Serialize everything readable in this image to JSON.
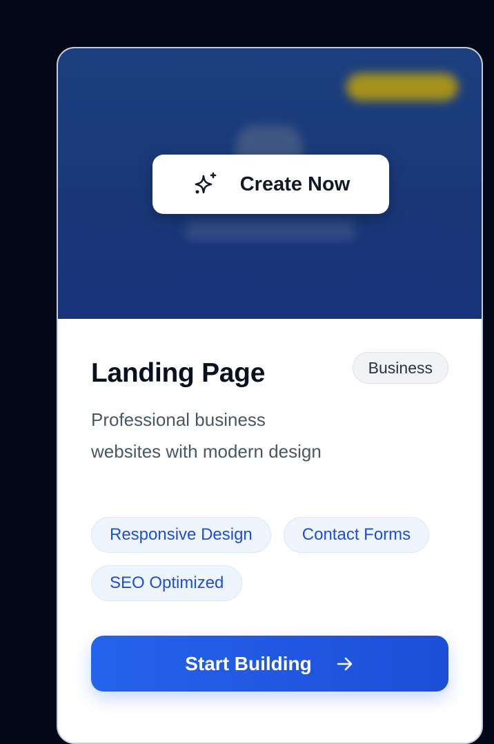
{
  "card": {
    "hero": {
      "create_label": "Create Now",
      "create_icon": "sparkles-icon"
    },
    "title": "Landing Page",
    "category": "Business",
    "description": "Professional business websites with modern design",
    "features": [
      "Responsive Design",
      "Contact Forms",
      "SEO Optimized"
    ],
    "cta_label": "Start Building",
    "cta_icon": "arrow-right-icon"
  },
  "colors": {
    "page_bg": "#020817",
    "hero_bg": "#1a3878",
    "accent": "#2563eb",
    "tag_text": "#1d4ed8"
  }
}
